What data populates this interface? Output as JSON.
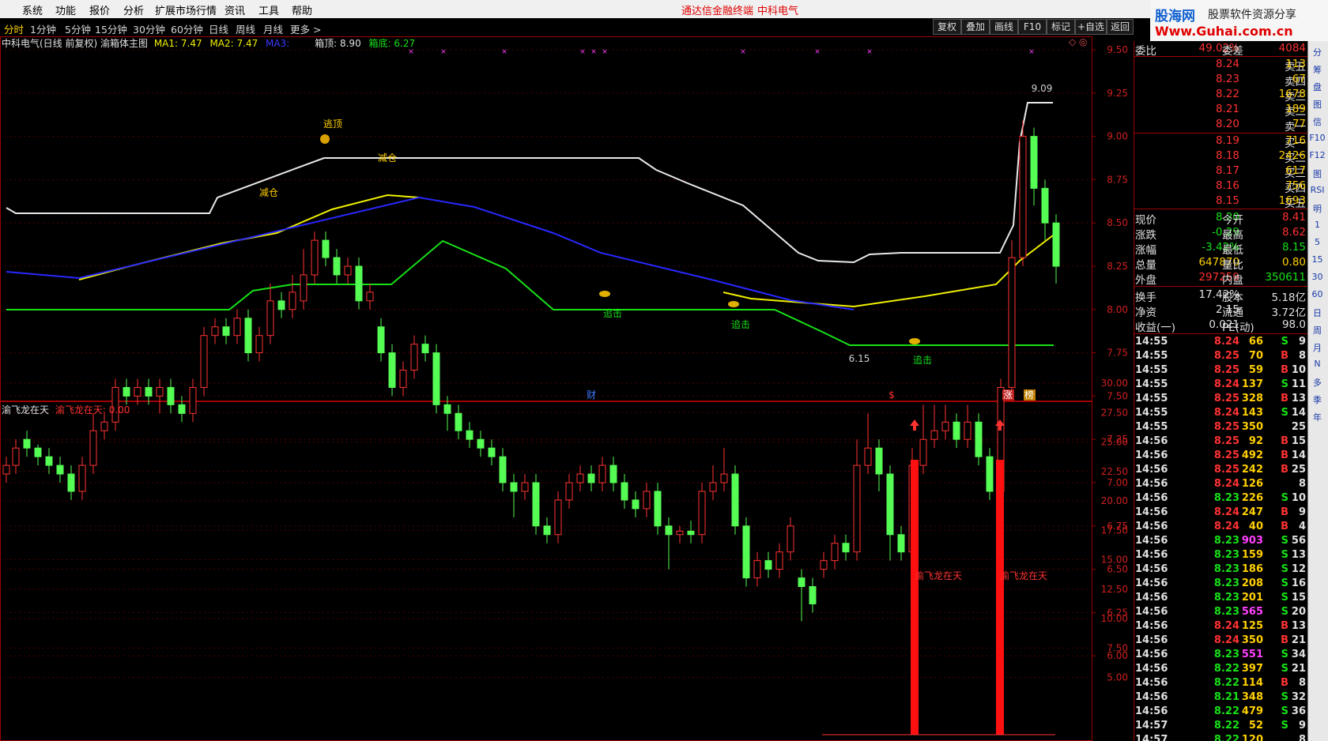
{
  "menu": [
    "系统",
    "功能",
    "报价",
    "分析",
    "扩展市场行情",
    "资讯",
    "工具",
    "帮助"
  ],
  "menu_title": "通达信金融终端",
  "menu_stock": "中科电气",
  "logo": {
    "cn": "股海网",
    "sub": "股票软件资源分享",
    "url": "Www.Guhai.com.cn"
  },
  "periods": [
    "分时",
    "1分钟",
    "5分钟",
    "15分钟",
    "30分钟",
    "60分钟",
    "日线",
    "周线",
    "月线",
    "更多 >"
  ],
  "active_period": "分时",
  "toolbar": [
    "复权",
    "叠加",
    "画线",
    "F10",
    "标记",
    "+自选",
    "返回"
  ],
  "info": {
    "title": "中科电气(日线 前复权) 渝箱体主图",
    "ma1": "MA1: 7.47",
    "ma2": "MA2: 7.47",
    "ma3": "MA3:",
    "top": "箱顶: 8.90",
    "bot": "箱底: 6.27"
  },
  "sub_info": {
    "name": "渝飞龙在天",
    "val": "渝飞龙在天: 0.00"
  },
  "price_axis": [
    "9.50",
    "9.25",
    "9.00",
    "8.75",
    "8.50",
    "8.25",
    "8.00",
    "7.75",
    "7.50",
    "7.25",
    "7.00",
    "6.75",
    "6.50",
    "6.25",
    "6.00"
  ],
  "sub_axis": [
    "30.00",
    "27.50",
    "25.00",
    "22.50",
    "20.00",
    "17.50",
    "15.00",
    "12.50",
    "10.00",
    "7.50",
    "5.00"
  ],
  "annotations": {
    "escape": "逃顶",
    "reduce1": "减仓",
    "reduce2": "减仓",
    "chase1": "追击",
    "chase2": "追击",
    "chase3": "追击",
    "high": "9.09",
    "low": "6.15",
    "cai": "财",
    "zhang": "涨",
    "bang": "榜",
    "dollar": "$",
    "signal1": "渝飞龙在天",
    "signal2": "渝飞龙在天"
  },
  "colors": {
    "up": "#ff3232",
    "down": "#54fc54",
    "white_line": "#e8e8e8",
    "yellow_line": "#f0f000",
    "blue_line": "#2828ff",
    "green_line": "#18e018",
    "frame": "#a00000"
  },
  "quote": {
    "weibi_label": "委比",
    "weibi": "49.02%",
    "weicha_label": "委差",
    "weicha": "4084",
    "asks": [
      [
        "卖五",
        "8.24",
        "113"
      ],
      [
        "卖四",
        "8.23",
        "67"
      ],
      [
        "卖三",
        "8.22",
        "1678"
      ],
      [
        "卖二",
        "8.21",
        "189"
      ],
      [
        "卖一",
        "8.20",
        "77"
      ]
    ],
    "bids": [
      [
        "买一",
        "8.19",
        "716"
      ],
      [
        "买二",
        "8.18",
        "2426"
      ],
      [
        "买三",
        "8.17",
        "617"
      ],
      [
        "买四",
        "8.16",
        "756"
      ],
      [
        "买五",
        "8.15",
        "1693"
      ]
    ],
    "stats": [
      [
        "现价",
        "8.20",
        "今开",
        "8.41"
      ],
      [
        "涨跌",
        "-0.29",
        "最高",
        "8.62"
      ],
      [
        "涨幅",
        "-3.42%",
        "最低",
        "8.15"
      ],
      [
        "总量",
        "647870",
        "量比",
        "0.80"
      ],
      [
        "外盘",
        "297259",
        "内盘",
        "350611"
      ]
    ],
    "stats2": [
      [
        "换手",
        "17.42%",
        "股本",
        "5.18亿"
      ],
      [
        "净资",
        "2.15",
        "流通",
        "3.72亿"
      ],
      [
        "收益(一)",
        "0.021",
        "PE(动)",
        "98.0"
      ]
    ]
  },
  "ticks": [
    [
      "14:55",
      "8.24",
      "66",
      "S",
      "9"
    ],
    [
      "14:55",
      "8.25",
      "70",
      "B",
      "8"
    ],
    [
      "14:55",
      "8.25",
      "59",
      "B",
      "10"
    ],
    [
      "14:55",
      "8.24",
      "137",
      "S",
      "11"
    ],
    [
      "14:55",
      "8.25",
      "328",
      "B",
      "13"
    ],
    [
      "14:55",
      "8.24",
      "143",
      "S",
      "14"
    ],
    [
      "14:55",
      "8.25",
      "350",
      "",
      "25"
    ],
    [
      "14:56",
      "8.25",
      "92",
      "B",
      "15"
    ],
    [
      "14:56",
      "8.25",
      "492",
      "B",
      "14"
    ],
    [
      "14:56",
      "8.25",
      "242",
      "B",
      "25"
    ],
    [
      "14:56",
      "8.24",
      "126",
      "",
      "8"
    ],
    [
      "14:56",
      "8.23",
      "226",
      "S",
      "10"
    ],
    [
      "14:56",
      "8.24",
      "247",
      "B",
      "9"
    ],
    [
      "14:56",
      "8.24",
      "40",
      "B",
      "4"
    ],
    [
      "14:56",
      "8.23",
      "903",
      "S",
      "56"
    ],
    [
      "14:56",
      "8.23",
      "159",
      "S",
      "13"
    ],
    [
      "14:56",
      "8.23",
      "186",
      "S",
      "12"
    ],
    [
      "14:56",
      "8.23",
      "208",
      "S",
      "16"
    ],
    [
      "14:56",
      "8.23",
      "201",
      "S",
      "15"
    ],
    [
      "14:56",
      "8.23",
      "565",
      "S",
      "20"
    ],
    [
      "14:56",
      "8.24",
      "125",
      "B",
      "13"
    ],
    [
      "14:56",
      "8.24",
      "350",
      "B",
      "21"
    ],
    [
      "14:56",
      "8.23",
      "551",
      "S",
      "34"
    ],
    [
      "14:56",
      "8.22",
      "397",
      "S",
      "21"
    ],
    [
      "14:56",
      "8.22",
      "114",
      "B",
      "8"
    ],
    [
      "14:56",
      "8.21",
      "348",
      "S",
      "32"
    ],
    [
      "14:56",
      "8.22",
      "479",
      "S",
      "36"
    ],
    [
      "14:57",
      "8.22",
      "52",
      "S",
      "9"
    ],
    [
      "14:57",
      "8.22",
      "120",
      "",
      "8"
    ]
  ],
  "sidebar": [
    "分",
    "筹",
    "盘",
    "图",
    "信",
    "F10",
    "F12",
    "图",
    "RSI",
    "明",
    "1",
    "5",
    "15",
    "30",
    "60",
    "日",
    "周",
    "月",
    "N",
    "多",
    "季",
    "年"
  ]
}
